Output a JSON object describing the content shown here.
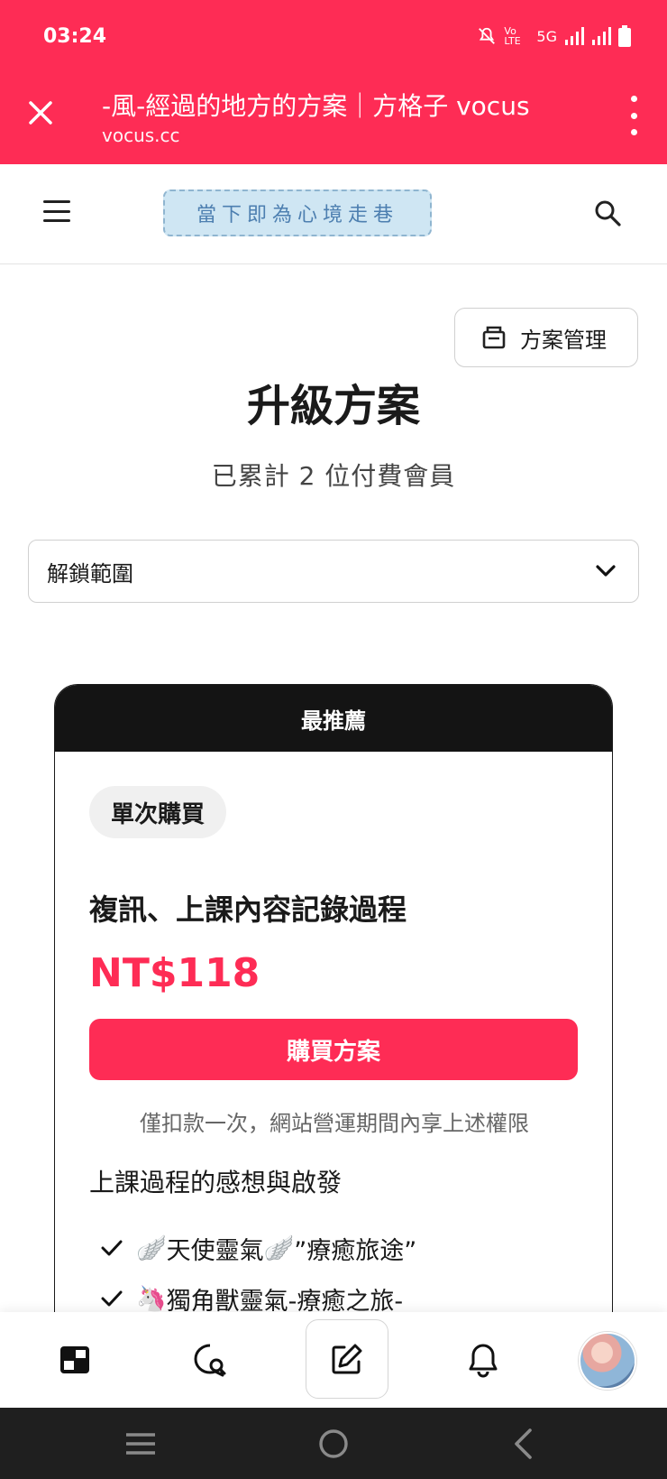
{
  "status_bar": {
    "time": "03:24",
    "network": "5G",
    "volte": "Vo LTE"
  },
  "browser": {
    "page_title": "-風-經過的地方的方案｜方格子 vocus",
    "url": "vocus.cc"
  },
  "header": {
    "logo_text": "當下即為心境走巷"
  },
  "manage_button": {
    "label": "方案管理"
  },
  "main": {
    "title": "升級方案",
    "subtitle": "已累計 2 位付費會員"
  },
  "unlock_select": {
    "label": "解鎖範圍"
  },
  "plan": {
    "ribbon": "最推薦",
    "type": "單次購買",
    "name": "複訊、上課內容記錄過程",
    "price": "NT$118",
    "buy_label": "購買方案",
    "note": "僅扣款一次，網站營運期間內享上述權限",
    "description": "上課過程的感想與啟發",
    "benefits": [
      {
        "icon": "🪽",
        "text": "天使靈氣",
        "icon_after": "🪽",
        "text_after": "”療癒旅途”"
      },
      {
        "icon": "🦄",
        "text": "獨角獸靈氣-療癒之旅-"
      }
    ]
  },
  "colors": {
    "accent": "#fe2c55",
    "ribbon": "#141414"
  }
}
